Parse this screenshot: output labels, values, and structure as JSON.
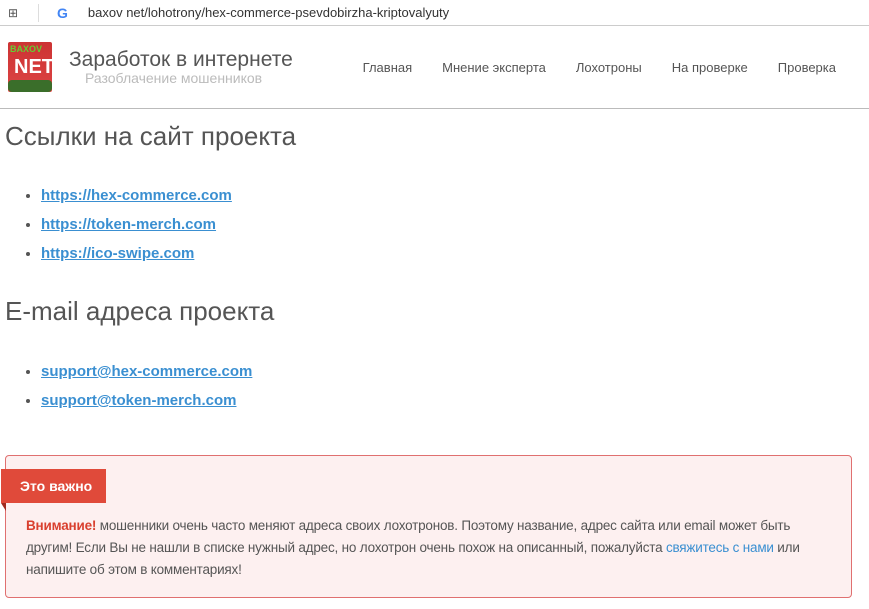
{
  "browser": {
    "url": "baxov net/lohotrony/hex-commerce-psevdobirzha-kriptovalyuty"
  },
  "site": {
    "logo_text_top": "BAXOV",
    "logo_text_main": "NET",
    "title": "Заработок в интернете",
    "subtitle": "Разоблачение мошенников"
  },
  "nav": [
    "Главная",
    "Мнение эксперта",
    "Лохотроны",
    "На проверке",
    "Проверка"
  ],
  "links_section": {
    "heading": "Ссылки на сайт проекта",
    "items": [
      "https://hex-commerce.com",
      "https://token-merch.com",
      "https://ico-swipe.com"
    ]
  },
  "email_section": {
    "heading": "E-mail адреса проекта",
    "items": [
      "support@hex-commerce.com",
      "support@token-merch.com"
    ]
  },
  "alert": {
    "badge": "Это важно",
    "warning": "Внимание!",
    "text1": " мошенники очень часто меняют адреса своих лохотронов. Поэтому название, адрес сайта или email может быть другим! Если Вы не нашли в списке нужный адрес, но лохотрон очень похож на описанный, пожалуйста ",
    "link": "свяжитесь с нами",
    "text2": " или напишите об этом в комментариях!"
  }
}
